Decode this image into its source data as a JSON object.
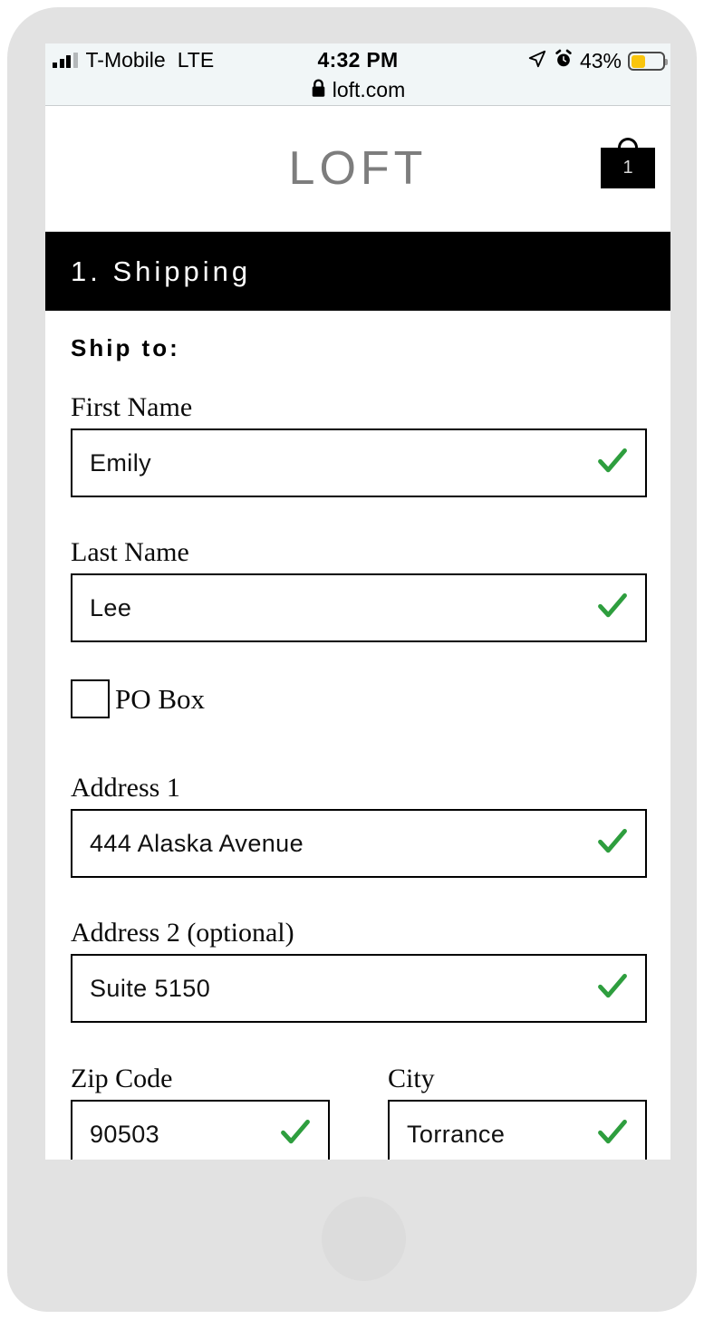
{
  "status_bar": {
    "carrier": "T-Mobile",
    "network": "LTE",
    "time": "4:32 PM",
    "battery_percent": "43%",
    "battery_level": 43,
    "battery_color": "#f9c50d",
    "signal_bars_filled": 3,
    "signal_bars_total": 4,
    "location_icon": "location-arrow-icon",
    "alarm_icon": "alarm-clock-icon"
  },
  "browser": {
    "lock_icon": "lock-icon",
    "url": "loft.com"
  },
  "site_header": {
    "brand": "LOFT",
    "brand_color": "#7d7d7d",
    "cart_icon": "shopping-bag-icon",
    "cart_count": "1"
  },
  "step_banner": {
    "title": "1. Shipping",
    "background": "#000000",
    "text_color": "#ffffff"
  },
  "form": {
    "heading": "Ship to:",
    "check_color": "#2e9e3e",
    "fields": [
      {
        "label": "First Name",
        "value": "Emily",
        "valid": true
      },
      {
        "label": "Last Name",
        "value": "Lee",
        "valid": true
      },
      {
        "label": "Address 1",
        "value": "444 Alaska Avenue",
        "valid": true
      },
      {
        "label": "Address 2 (optional)",
        "value": "Suite 5150",
        "valid": true
      },
      {
        "label": "Zip Code",
        "value": "90503",
        "valid": true
      },
      {
        "label": "City",
        "value": "Torrance",
        "valid": true
      }
    ],
    "po_box": {
      "label": "PO Box",
      "checked": false
    }
  }
}
